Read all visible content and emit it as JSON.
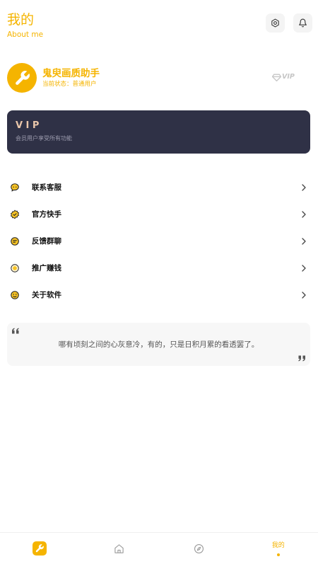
{
  "colors": {
    "accent": "#f5b400",
    "vip_card_bg": "#2f3146",
    "vip_title": "#e9c6aa",
    "icon_muted": "#9a9a9a"
  },
  "header": {
    "title": "我的",
    "subtitle": "About me",
    "actions": [
      {
        "icon": "settings-icon"
      },
      {
        "icon": "bell-icon"
      }
    ]
  },
  "profile": {
    "avatar_icon": "wrench-icon",
    "name": "鬼臾画质助手",
    "status": "当前状态：普通用户",
    "badge_icon": "gem-icon",
    "badge_label": "VIP"
  },
  "vip_card": {
    "title": "VIP",
    "description": "会员用户享受所有功能"
  },
  "menu": [
    {
      "label": "联系客服",
      "icon": "service-chat-icon",
      "chevron_icon": "chevron-right-icon"
    },
    {
      "label": "官方快手",
      "icon": "kuaishou-icon",
      "chevron_icon": "chevron-right-icon"
    },
    {
      "label": "反馈群聊",
      "icon": "group-chat-icon",
      "chevron_icon": "chevron-right-icon"
    },
    {
      "label": "推广赚钱",
      "icon": "coin-icon",
      "chevron_icon": "chevron-right-icon"
    },
    {
      "label": "关于软件",
      "icon": "about-face-icon",
      "chevron_icon": "chevron-right-icon"
    }
  ],
  "quote": {
    "text": "哪有顷刻之间的心灰意冷，有的，只是日积月累的看透罢了。",
    "open_icon": "quote-open-icon",
    "close_icon": "quote-close-icon"
  },
  "tabbar": {
    "items": [
      {
        "icon": "wrench-icon",
        "active": false
      },
      {
        "icon": "home-icon",
        "active": false
      },
      {
        "icon": "compass-icon",
        "active": false
      },
      {
        "label": "我的",
        "active": true
      }
    ]
  }
}
